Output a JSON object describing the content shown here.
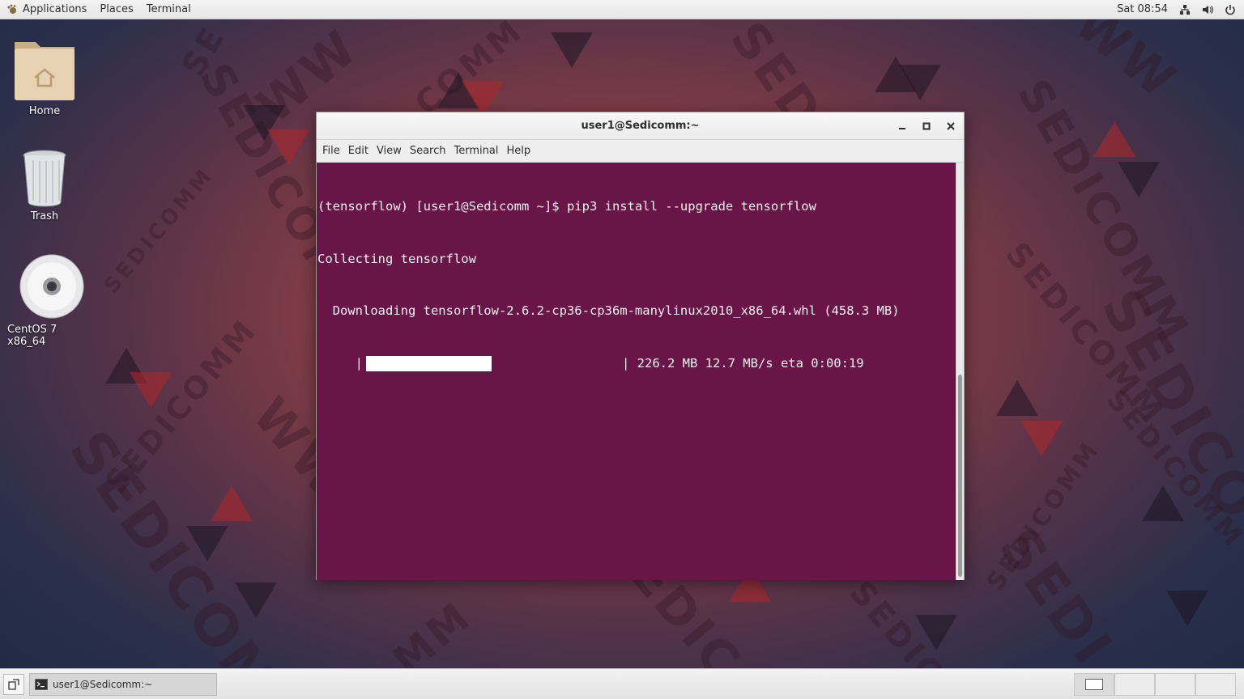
{
  "top_panel": {
    "applications": "Applications",
    "places": "Places",
    "terminal": "Terminal",
    "clock": "Sat 08:54"
  },
  "desktop": {
    "icons": [
      {
        "label": "Home",
        "icon": "home-folder-icon"
      },
      {
        "label": "Trash",
        "icon": "trash-icon"
      },
      {
        "label": "CentOS 7 x86_64",
        "icon": "disc-icon"
      }
    ]
  },
  "window": {
    "title": "user1@Sedicomm:~",
    "menu": [
      "File",
      "Edit",
      "View",
      "Search",
      "Terminal",
      "Help"
    ],
    "terminal": {
      "background": "#6a1548",
      "line1": "(tensorflow) [user1@Sedicomm ~]$ pip3 install --upgrade tensorflow",
      "line2": "Collecting tensorflow",
      "line3": "  Downloading tensorflow-2.6.2-cp36-cp36m-manylinux2010_x86_64.whl (458.3 MB)",
      "progress_left": "     |",
      "progress_right": "| 226.2 MB 12.7 MB/s eta 0:00:19",
      "progress_fraction": 0.49
    }
  },
  "taskbar": {
    "task_label": "user1@Sedicomm:~"
  }
}
